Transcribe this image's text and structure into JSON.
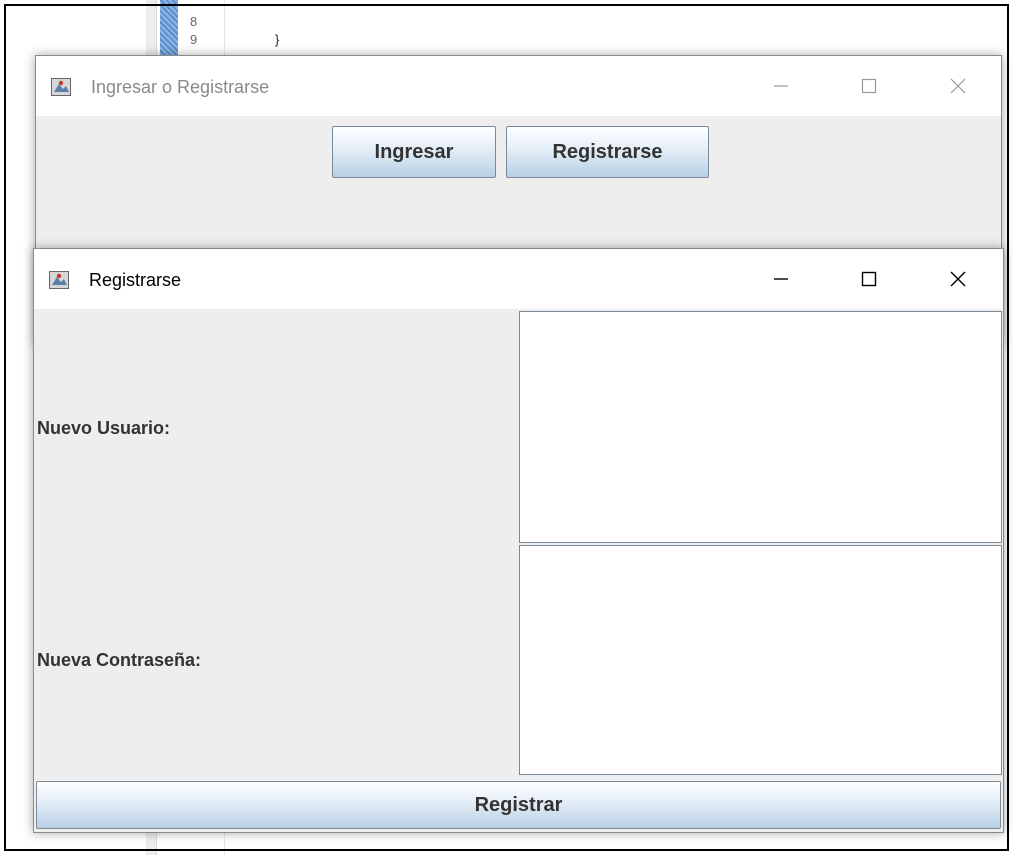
{
  "editor": {
    "lines": [
      {
        "number": "8",
        "code": ""
      },
      {
        "number": "9",
        "code": "}"
      }
    ]
  },
  "login_window": {
    "title": "Ingresar o Registrarse",
    "buttons": {
      "ingresar": "Ingresar",
      "registrarse": "Registrarse"
    }
  },
  "register_window": {
    "title": "Registrarse",
    "fields": {
      "usuario": {
        "label": "Nuevo Usuario:",
        "value": ""
      },
      "contrasena": {
        "label": "Nueva Contraseña:",
        "value": ""
      }
    },
    "submit_label": "Registrar"
  },
  "colors": {
    "window_bg": "#eeeeee",
    "titlebar_bg": "#ffffff",
    "inactive_title": "#8a8a8a",
    "active_title": "#000000"
  }
}
